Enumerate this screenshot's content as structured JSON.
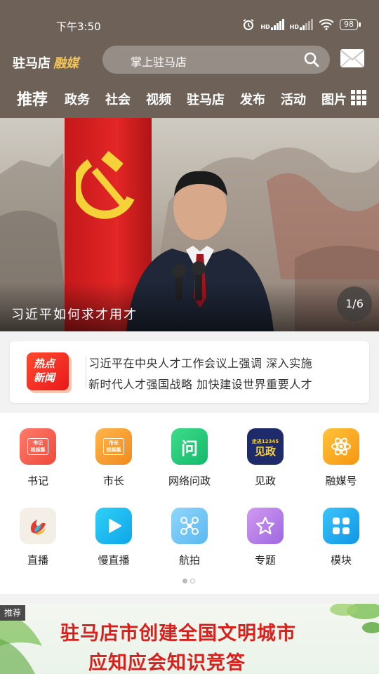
{
  "status_bar": {
    "time": "下午3:50",
    "battery": "98",
    "hd1": "HD",
    "hd2": "HD"
  },
  "header": {
    "brand_main": "驻马店",
    "brand_accent": "融媒",
    "search_placeholder": "掌上驻马店",
    "search_icon": "search-icon",
    "mail_icon": "mail-icon",
    "colors": {
      "header_bg": "#6e6258",
      "brand_accent": "#f3c45a"
    }
  },
  "nav": {
    "tabs": [
      {
        "label": "推荐",
        "active": true
      },
      {
        "label": "政务"
      },
      {
        "label": "社会"
      },
      {
        "label": "视频"
      },
      {
        "label": "驻马店"
      },
      {
        "label": "发布"
      },
      {
        "label": "活动"
      },
      {
        "label": "图片"
      }
    ],
    "more_icon": "grid-icon"
  },
  "banner": {
    "caption": "习近平如何求才用才",
    "counter": "1/6"
  },
  "hot_news": {
    "badge_line1": "热点",
    "badge_line2": "新闻",
    "line1": "习近平在中央人才工作会议上强调 深入实施",
    "line2": "新时代人才强国战略 加快建设世界重要人才"
  },
  "shortcuts": [
    {
      "label": "书记",
      "icon": "secretary-video-icon",
      "icon_text": "书记",
      "icon_sub": "视频集",
      "color": "#f25f4c"
    },
    {
      "label": "市长",
      "icon": "mayor-video-icon",
      "icon_text": "市长",
      "icon_sub": "视频集",
      "color": "#f59a2f"
    },
    {
      "label": "网络问政",
      "icon": "inquiry-icon",
      "icon_text": "问",
      "color": "#23c978"
    },
    {
      "label": "见政",
      "icon": "jianzheng-icon",
      "icon_text": "走进12345",
      "icon_sub": "见政",
      "color": "#1f2a6b"
    },
    {
      "label": "融媒号",
      "icon": "atom-icon",
      "color": "#f7a21b"
    },
    {
      "label": "直播",
      "icon": "live-icon",
      "color": "#f0eadf"
    },
    {
      "label": "慢直播",
      "icon": "play-icon",
      "color": "#18b8f0"
    },
    {
      "label": "航拍",
      "icon": "drone-icon",
      "color": "#6cc6f5"
    },
    {
      "label": "专题",
      "icon": "star-icon",
      "color": "#b57ee8"
    },
    {
      "label": "模块",
      "icon": "modules-icon",
      "color": "#1aa8ef"
    }
  ],
  "pager": {
    "pages": 2,
    "current": 1
  },
  "promo": {
    "tag": "推荐",
    "line1": "驻马店市创建全国文明城市",
    "line2": "应知应会知识竞答"
  }
}
